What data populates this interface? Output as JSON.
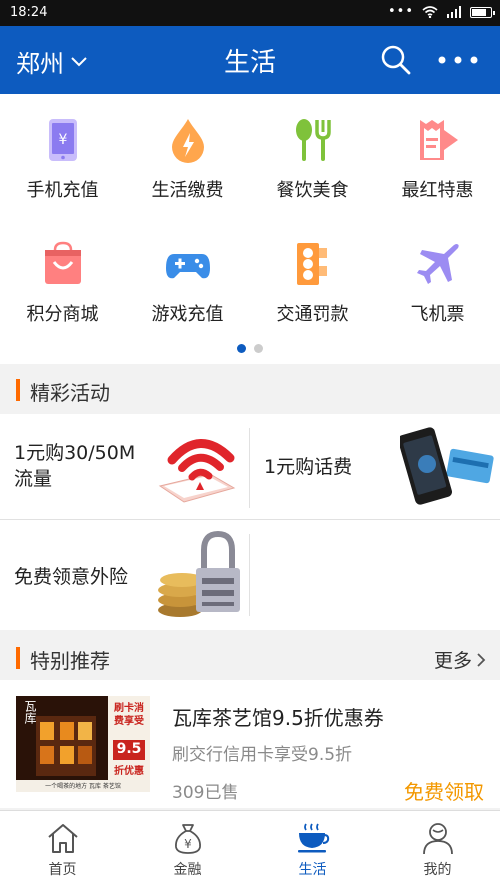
{
  "status": {
    "time": "18:24",
    "dots": "•••"
  },
  "header": {
    "city": "郑州",
    "title": "生活"
  },
  "grid": [
    {
      "label": "手机充值",
      "icon": "phone-recharge-icon"
    },
    {
      "label": "生活缴费",
      "icon": "utility-bill-icon"
    },
    {
      "label": "餐饮美食",
      "icon": "dining-icon"
    },
    {
      "label": "最红特惠",
      "icon": "discount-tag-icon"
    },
    {
      "label": "积分商城",
      "icon": "points-mall-icon"
    },
    {
      "label": "游戏充值",
      "icon": "gamepad-icon"
    },
    {
      "label": "交通罚款",
      "icon": "traffic-light-icon"
    },
    {
      "label": "飞机票",
      "icon": "airplane-icon"
    }
  ],
  "pager": {
    "pages": 2,
    "active": 0
  },
  "activities": {
    "title": "精彩活动",
    "items": [
      {
        "label": "1元购30/50M流量"
      },
      {
        "label": "1元购话费"
      },
      {
        "label": "免费领意外险"
      }
    ]
  },
  "recommend": {
    "title": "特别推荐",
    "more": "更多",
    "item": {
      "name": "瓦库茶艺馆9.5折优惠券",
      "desc": "刷交行信用卡享受9.5折",
      "sold": "309已售",
      "action": "免费领取",
      "thumb_text": {
        "promo_top": "刷卡消费享受",
        "promo_num": "9.5",
        "promo_bottom": "折优惠",
        "brand": "瓦库",
        "caption": "一个喝茶的地方 瓦库 茶艺馆"
      }
    }
  },
  "tabs": [
    {
      "label": "首页",
      "icon": "home-icon"
    },
    {
      "label": "金融",
      "icon": "money-bag-icon"
    },
    {
      "label": "生活",
      "icon": "coffee-cup-icon",
      "active": true
    },
    {
      "label": "我的",
      "icon": "user-icon"
    }
  ],
  "colors": {
    "brand": "#0d5bbf",
    "accent": "#ff6a00",
    "action": "#f39800"
  }
}
